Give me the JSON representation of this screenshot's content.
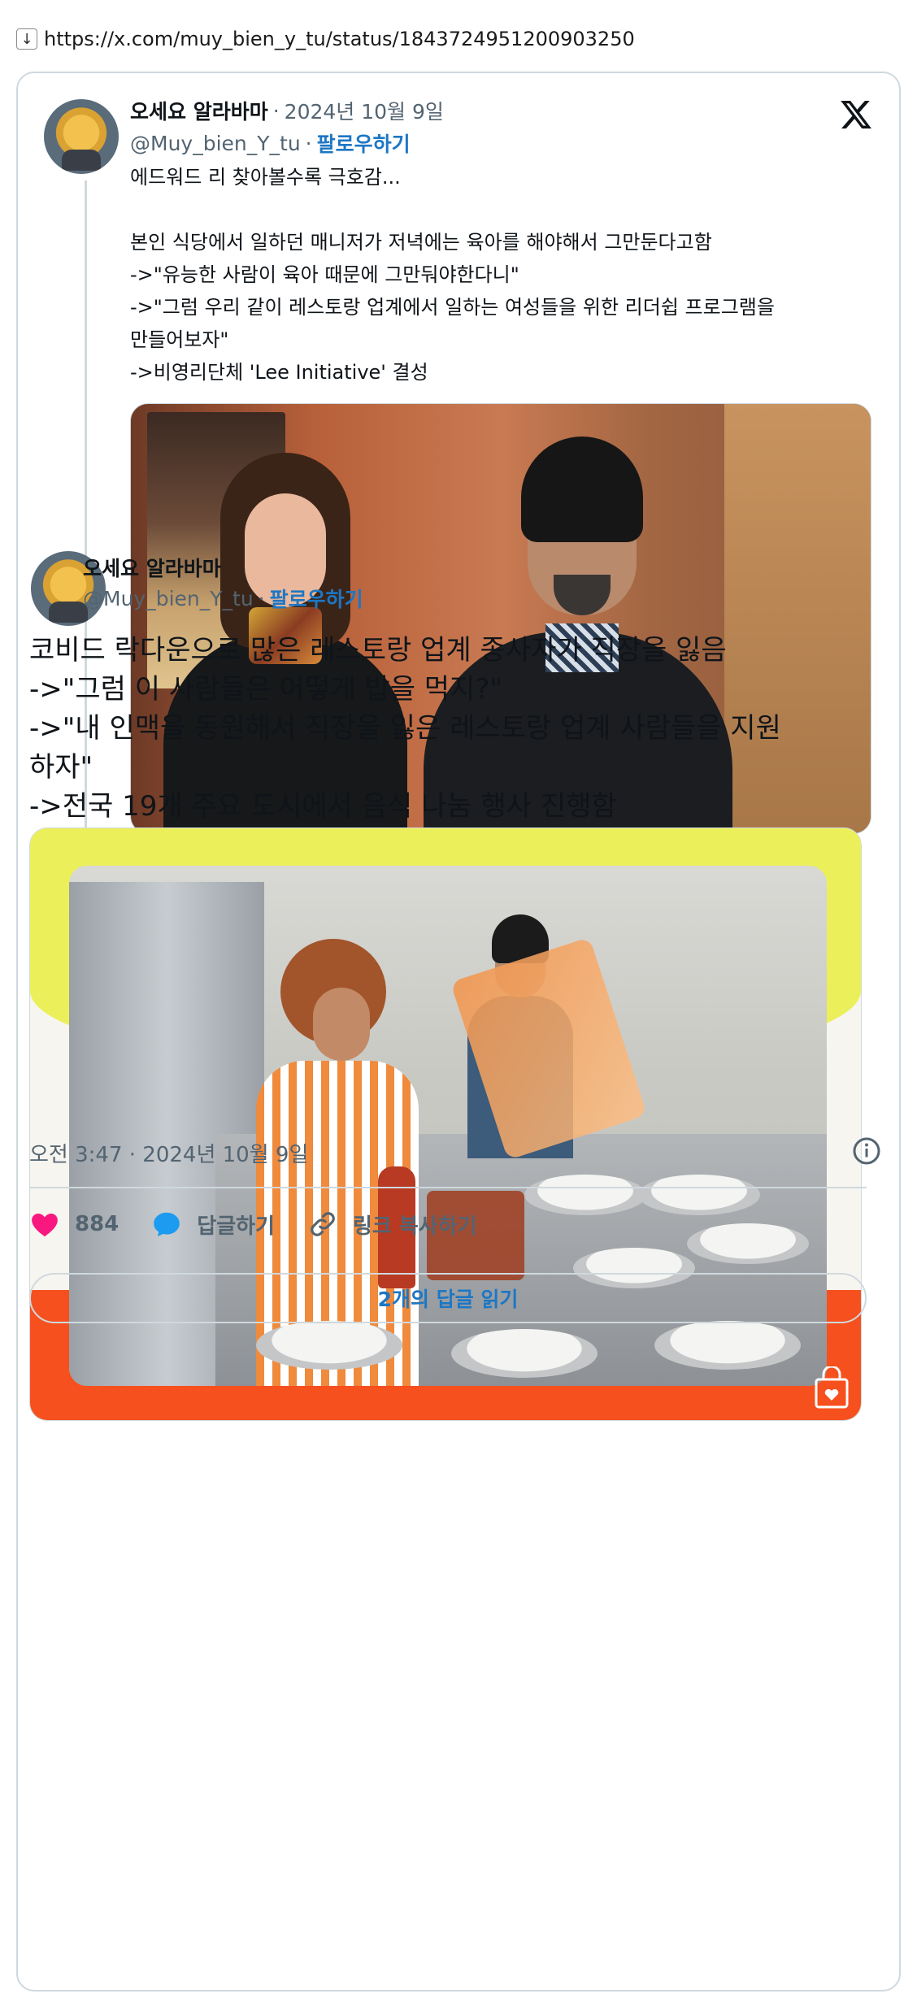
{
  "url_bar": {
    "icon": "download-arrow-icon",
    "url": "https://x.com/muy_bien_y_tu/status/1843724951200903250"
  },
  "tweet1": {
    "name": "오세요 알라바마",
    "separator": "·",
    "date": "2024년 10월 9일",
    "handle": "@Muy_bien_Y_tu",
    "follow_separator": "·",
    "follow_label": "팔로우하기",
    "text": "에드워드 리 찾아볼수록 극호감...\n\n본인 식당에서 일하던 매니저가 저녁에는 육아를 해야해서 그만둔다고함\n->\"유능한 사람이 육아 때문에 그만둬야한다니\"\n->\"그럼 우리 같이 레스토랑 업계에서 일하는 여성들을 위한 리더쉽 프로그램을\n만들어보자\"\n->비영리단체 'Lee Initiative' 결성"
  },
  "tweet2": {
    "name": "오세요 알라바마",
    "handle": "@Muy_bien_Y_tu",
    "follow_separator": "·",
    "follow_label": "팔로우하기",
    "text": "코비드 락다운으로 많은 레스토랑 업계 종사자가 직장을 잃음\n->\"그럼 이 사람들은 어떻게 밥을 먹지?\"\n->\"내 인맥을 동원해서 직장을 잃은 레스토랑 업계 사람들을 지원\n하자\"\n->전국 19개 주요 도시에서 음식 나눔 행사 진행함",
    "timestamp": "오전 3:47 · 2024년 10월 9일"
  },
  "actions": {
    "likes_count": "884",
    "reply_label": "답글하기",
    "copy_link_label": "링크 복사하기"
  },
  "read_replies_label": "2개의 답글 읽기",
  "colors": {
    "accent_blue": "#1d77c4",
    "like_pink": "#f91880",
    "reply_blue": "#1d9bf0",
    "border": "#cfd9de",
    "secondary_text": "#536471"
  },
  "icons": {
    "x_logo": "x-logo-icon",
    "info": "info-icon",
    "heart": "heart-icon",
    "reply": "reply-bubble-icon",
    "link": "link-icon",
    "bag": "shopping-bag-heart-icon"
  }
}
